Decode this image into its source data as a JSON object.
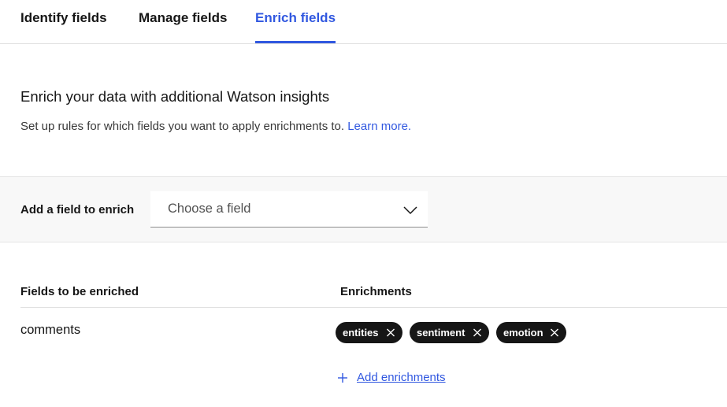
{
  "tabs": [
    {
      "label": "Identify fields"
    },
    {
      "label": "Manage fields"
    },
    {
      "label": "Enrich fields"
    }
  ],
  "active_tab": "Enrich fields",
  "main": {
    "heading": "Enrich your data with additional Watson insights",
    "description": "Set up rules for which fields you want to apply enrichments to. ",
    "learn_more": "Learn more."
  },
  "add_field": {
    "label": "Add a field to enrich",
    "placeholder": "Choose a field"
  },
  "table": {
    "columns": [
      "Fields to be enriched",
      "Enrichments"
    ],
    "rows": [
      {
        "field": "comments",
        "enrichments": [
          "entities",
          "sentiment",
          "emotion"
        ]
      }
    ],
    "add_enrichments": "Add enrichments"
  },
  "colors": {
    "accent": "#3158e0",
    "tag_bg": "#161616",
    "band_bg": "#f8f8f8"
  }
}
